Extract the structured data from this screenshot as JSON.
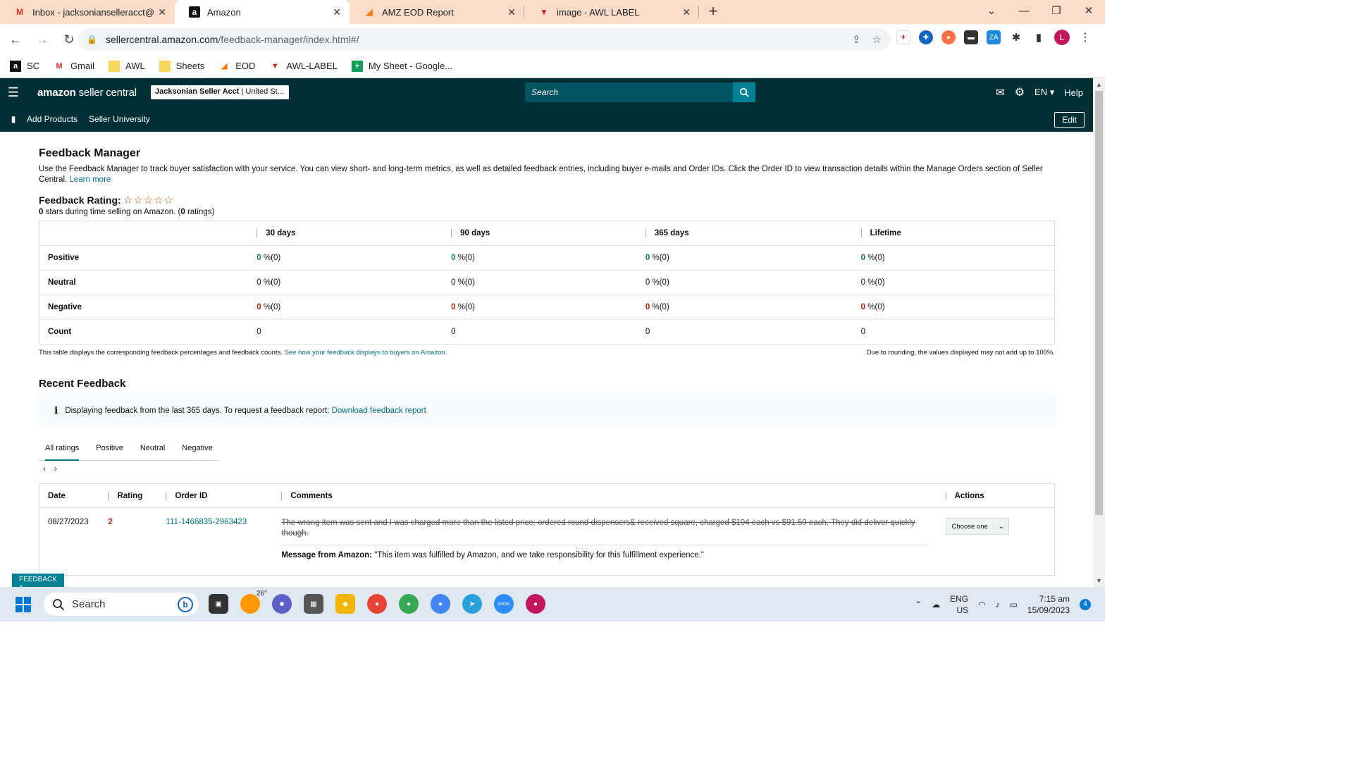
{
  "browser": {
    "tabs": [
      {
        "title": "Inbox - jacksonianselleracct@gm",
        "favicon": "gmail-icon",
        "active": false
      },
      {
        "title": "Amazon",
        "favicon": "amazon-icon",
        "active": true
      },
      {
        "title": "AMZ EOD Report",
        "favicon": "eod-icon",
        "active": false
      },
      {
        "title": "image - AWL LABEL",
        "favicon": "awl-label-icon",
        "active": false
      }
    ],
    "url_host": "sellercentral.amazon.com",
    "url_path": "/feedback-manager/index.html#/",
    "profile_initial": "L",
    "bookmarks": [
      {
        "label": "SC"
      },
      {
        "label": "Gmail"
      },
      {
        "label": "AWL"
      },
      {
        "label": "Sheets"
      },
      {
        "label": "EOD"
      },
      {
        "label": "AWL-LABEL"
      },
      {
        "label": "My Sheet - Google..."
      }
    ]
  },
  "header": {
    "logo_bold": "amazon",
    "logo_rest": " seller central",
    "account_name": "Jacksonian Seller Acct",
    "account_region": " | United St...",
    "search_placeholder": "Search",
    "language": "EN",
    "help": "Help"
  },
  "subnav": {
    "items": [
      "Add Products",
      "Seller University"
    ],
    "edit": "Edit"
  },
  "page": {
    "title": "Feedback Manager",
    "description": "Use the Feedback Manager to track buyer satisfaction with your service. You can view short- and long-term metrics, as well as detailed feedback entries, including buyer e-mails and Order IDs. Click the Order ID to view transaction details within the Manage Orders section of Seller Central.",
    "learn_more": "Learn more",
    "rating_label": "Feedback Rating:",
    "stars": "☆☆☆☆☆",
    "rating_stars_value": "0",
    "rating_sub_middle": " stars during time selling on Amazon. (",
    "rating_count": "0",
    "rating_sub_end": " ratings)"
  },
  "metrics": {
    "columns": [
      "30 days",
      "90 days",
      "365 days",
      "Lifetime"
    ],
    "rows": [
      {
        "label": "Positive",
        "cells": [
          "0",
          "0",
          "0",
          "0"
        ],
        "suffix": " %(0)"
      },
      {
        "label": "Neutral",
        "cells": [
          "0",
          "0",
          "0",
          "0"
        ],
        "suffix": " %(0)"
      },
      {
        "label": "Negative",
        "cells": [
          "0",
          "0",
          "0",
          "0"
        ],
        "suffix": " %(0)"
      },
      {
        "label": "Count",
        "cells": [
          "0",
          "0",
          "0",
          "0"
        ],
        "suffix": ""
      }
    ],
    "note_left": "This table displays the corresponding feedback percentages and feedback counts.",
    "note_link": "See how your feedback displays to buyers on Amazon.",
    "note_right": "Due to rounding, the values displayed may not add up to 100%."
  },
  "recent": {
    "title": "Recent Feedback",
    "alert_text": "Displaying feedback from the last 365 days. To request a feedback report:",
    "alert_link": "Download feedback report",
    "tabs": [
      "All ratings",
      "Positive",
      "Neutral",
      "Negative"
    ],
    "columns": [
      "Date",
      "Rating",
      "Order ID",
      "Comments",
      "Actions"
    ],
    "rows": [
      {
        "date": "08/27/2023",
        "rating": "2",
        "order_id": "111-1466835-2963423",
        "comment": "The wrong item was sent and I was charged more than the listed price; ordered round dispensers& received square, charged $104 each vs $91.50 each. They did deliver quickly though.",
        "amazon_label": "Message from Amazon:",
        "amazon_msg": " \"This item was fulfilled by Amazon, and we take responsibility for this fulfillment experience.\"",
        "action": "Choose one"
      }
    ]
  },
  "feedback_tag": "FEEDBACK ×",
  "taskbar": {
    "search": "Search",
    "weather": "26°",
    "lang_top": "ENG",
    "lang_bottom": "US",
    "time": "7:15 am",
    "date": "15/09/2023",
    "notifications": "4"
  },
  "colors": {
    "header_bg": "#002f36",
    "link": "#007185",
    "positive": "#067d62",
    "negative": "#b12704",
    "tab_strip": "#fbdcc9"
  }
}
